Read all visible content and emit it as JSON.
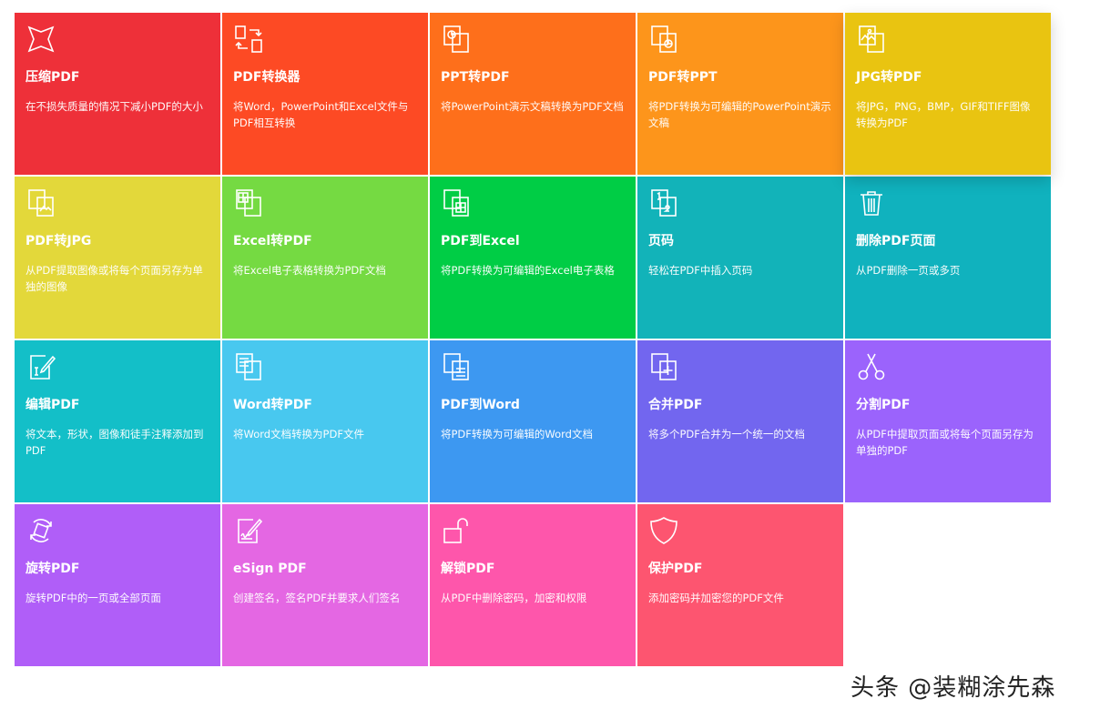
{
  "tiles": [
    {
      "title": "压缩PDF",
      "desc": "在不损失质量的情况下减小PDF的大小",
      "color": "#ee3039",
      "icon": "compress-icon"
    },
    {
      "title": "PDF转换器",
      "desc": "将Word，PowerPoint和Excel文件与PDF相互转换",
      "color": "#fd4a24",
      "icon": "convert-icon"
    },
    {
      "title": "PPT转PDF",
      "desc": "将PowerPoint演示文稿转换为PDF文档",
      "color": "#fe6f1b",
      "icon": "ppt-icon"
    },
    {
      "title": "PDF转PPT",
      "desc": "将PDF转换为可编辑的PowerPoint演示文稿",
      "color": "#fd951b",
      "icon": "pdf-to-ppt-icon"
    },
    {
      "title": "JPG转PDF",
      "desc": "将JPG，PNG，BMP，GIF和TIFF图像转换为PDF",
      "color": "#e9c411",
      "icon": "image-icon"
    },
    {
      "title": "PDF转JPG",
      "desc": "从PDF提取图像或将每个页面另存为单独的图像",
      "color": "#e3d83a",
      "icon": "pdf-to-jpg-icon"
    },
    {
      "title": "Excel转PDF",
      "desc": "将Excel电子表格转换为PDF文档",
      "color": "#75da42",
      "icon": "excel-icon"
    },
    {
      "title": "PDF到Excel",
      "desc": "将PDF转换为可编辑的Excel电子表格",
      "color": "#00cd45",
      "icon": "pdf-to-excel-icon"
    },
    {
      "title": "页码",
      "desc": "轻松在PDF中插入页码",
      "color": "#12b3b9",
      "icon": "page-number-icon"
    },
    {
      "title": "删除PDF页面",
      "desc": "从PDF删除一页或多页",
      "color": "#10b2be",
      "icon": "trash-icon"
    },
    {
      "title": "编辑PDF",
      "desc": "将文本，形状，图像和徒手注释添加到PDF",
      "color": "#13bfc8",
      "icon": "edit-icon"
    },
    {
      "title": "Word转PDF",
      "desc": "将Word文档转换为PDF文件",
      "color": "#48c8ef",
      "icon": "word-icon"
    },
    {
      "title": "PDF到Word",
      "desc": "将PDF转换为可编辑的Word文档",
      "color": "#3d98f1",
      "icon": "pdf-to-word-icon"
    },
    {
      "title": "合并PDF",
      "desc": "将多个PDF合并为一个统一的文档",
      "color": "#7266ef",
      "icon": "merge-icon"
    },
    {
      "title": "分割PDF",
      "desc": "从PDF中提取页面或将每个页面另存为单独的PDF",
      "color": "#9b63fc",
      "icon": "scissors-icon"
    },
    {
      "title": "旋转PDF",
      "desc": "旋转PDF中的一页或全部页面",
      "color": "#b05ef8",
      "icon": "rotate-icon"
    },
    {
      "title": "eSign PDF",
      "desc": "创建签名，签名PDF并要求人们签名",
      "color": "#e467e3",
      "icon": "esign-icon"
    },
    {
      "title": "解锁PDF",
      "desc": "从PDF中删除密码，加密和权限",
      "color": "#fe56ab",
      "icon": "unlock-icon"
    },
    {
      "title": "保护PDF",
      "desc": "添加密码并加密您的PDF文件",
      "color": "#fd5570",
      "icon": "shield-icon"
    }
  ],
  "watermark": "头条 @装糊涂先森"
}
